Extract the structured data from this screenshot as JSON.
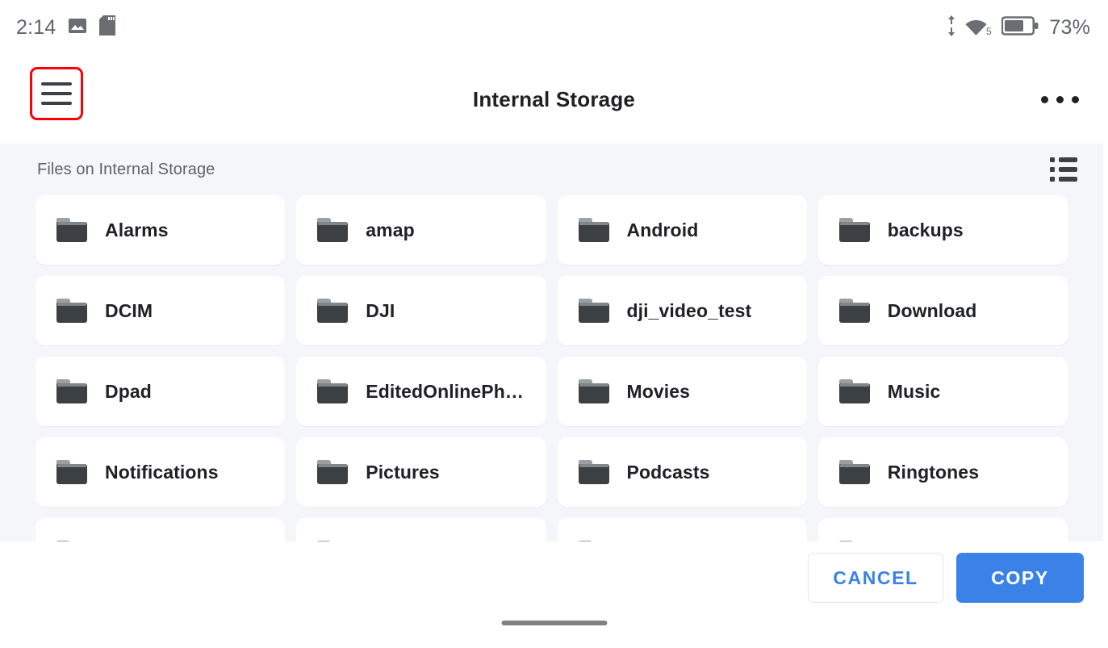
{
  "status_bar": {
    "time": "2:14",
    "battery_percent": "73%",
    "wifi_label": "5",
    "icons": [
      "image-icon",
      "sd-card-icon",
      "data-transfer-icon",
      "wifi-icon",
      "battery-icon"
    ]
  },
  "app_bar": {
    "title": "Internal Storage",
    "menu_icon": "hamburger-menu-icon",
    "overflow_icon": "overflow-menu-icon",
    "menu_highlight_color": "#fb0007"
  },
  "content": {
    "subtitle": "Files on Internal Storage",
    "view_toggle_icon": "list-view-icon",
    "folders": [
      {
        "name": "Alarms"
      },
      {
        "name": "amap"
      },
      {
        "name": "Android"
      },
      {
        "name": "backups"
      },
      {
        "name": "DCIM"
      },
      {
        "name": "DJI"
      },
      {
        "name": "dji_video_test"
      },
      {
        "name": "Download"
      },
      {
        "name": "Dpad"
      },
      {
        "name": "EditedOnlinePh…"
      },
      {
        "name": "Movies"
      },
      {
        "name": "Music"
      },
      {
        "name": "Notifications"
      },
      {
        "name": "Pictures"
      },
      {
        "name": "Podcasts"
      },
      {
        "name": "Ringtones"
      },
      {
        "name": ""
      },
      {
        "name": ""
      },
      {
        "name": ""
      },
      {
        "name": ""
      }
    ]
  },
  "footer": {
    "cancel_label": "CANCEL",
    "copy_label": "COPY",
    "accent_color": "#3b82e8"
  },
  "system_nav": {
    "home_indicator": "home-indicator"
  }
}
